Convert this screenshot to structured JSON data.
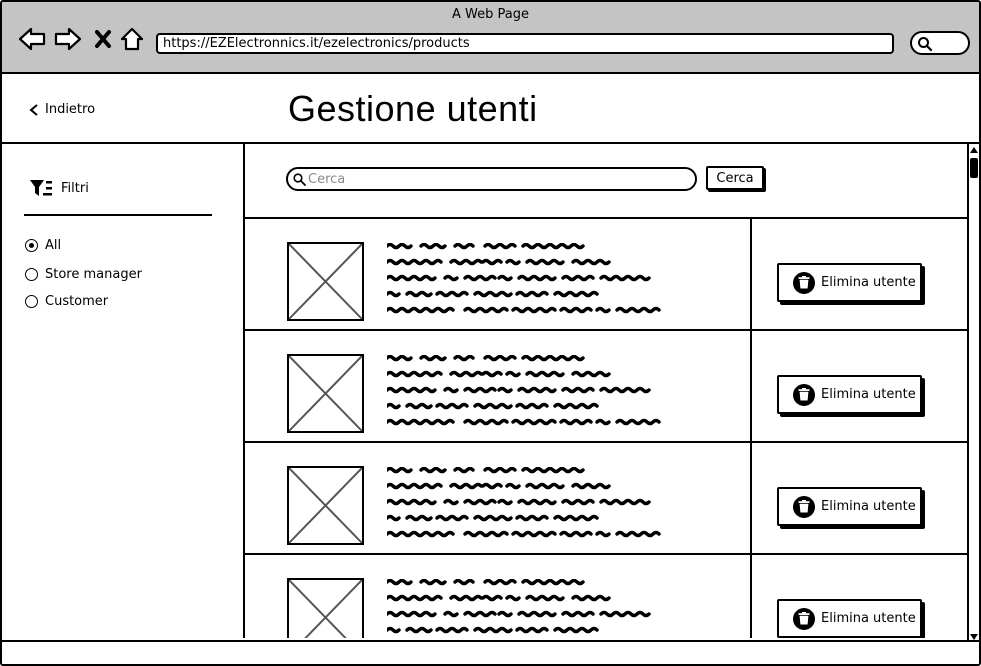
{
  "window": {
    "title": "A Web Page"
  },
  "browser": {
    "url": "https://EZElectronnics.it/ezelectronics/products",
    "back_icon": "arrow-left-icon",
    "forward_icon": "arrow-right-icon",
    "stop_icon": "close-icon",
    "home_icon": "home-icon",
    "search_icon": "search-icon"
  },
  "header": {
    "back_label": "Indietro",
    "title": "Gestione utenti"
  },
  "sidebar": {
    "filters_label": "Filtri",
    "filters_icon": "filter-icon",
    "options": [
      {
        "label": "All",
        "checked": true
      },
      {
        "label": "Store manager",
        "checked": false
      },
      {
        "label": "Customer",
        "checked": false
      }
    ]
  },
  "search": {
    "placeholder": "Cerca",
    "button_label": "Cerca"
  },
  "users": [
    {
      "delete_label": "Elimina utente"
    },
    {
      "delete_label": "Elimina utente"
    },
    {
      "delete_label": "Elimina utente"
    },
    {
      "delete_label": "Elimina utente"
    }
  ]
}
